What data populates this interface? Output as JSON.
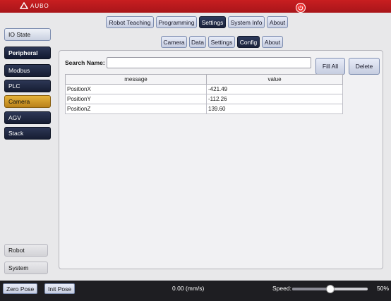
{
  "brand": {
    "name": "AUBO",
    "accent": "#c81e20"
  },
  "top_tabs": [
    {
      "label": "Robot Teaching",
      "active": false
    },
    {
      "label": "Programming",
      "active": false
    },
    {
      "label": "Settings",
      "active": true
    },
    {
      "label": "System Info",
      "active": false
    },
    {
      "label": "About",
      "active": false
    }
  ],
  "sub_tabs": [
    {
      "label": "Camera",
      "active": false
    },
    {
      "label": "Data",
      "active": false
    },
    {
      "label": "Settings",
      "active": false
    },
    {
      "label": "Config",
      "active": true
    },
    {
      "label": "About",
      "active": false
    }
  ],
  "sidebar": {
    "items": [
      {
        "label": "IO State",
        "style": "light"
      },
      {
        "label": "Peripheral",
        "style": "header"
      },
      {
        "label": "Modbus",
        "style": "dark"
      },
      {
        "label": "PLC",
        "style": "dark"
      },
      {
        "label": "Camera",
        "style": "active"
      },
      {
        "label": "AGV",
        "style": "dark"
      },
      {
        "label": "Stack",
        "style": "dark"
      }
    ],
    "bottom": [
      {
        "label": "Robot"
      },
      {
        "label": "System"
      }
    ]
  },
  "search": {
    "label": "Search Name:",
    "value": ""
  },
  "buttons": {
    "fill_all": "Fill All",
    "delete": "Delete"
  },
  "table": {
    "headers": [
      "message",
      "value"
    ],
    "rows": [
      [
        "PositionX",
        "-421.49"
      ],
      [
        "PositionY",
        "-112.26"
      ],
      [
        "PositionZ",
        "139.60"
      ]
    ]
  },
  "bottombar": {
    "zero_pose": "Zero Pose",
    "init_pose": "Init Pose",
    "velocity": "0.00 (mm/s)",
    "speed_label": "Speed:",
    "speed_value": 0.5,
    "speed_pct": "50%"
  }
}
